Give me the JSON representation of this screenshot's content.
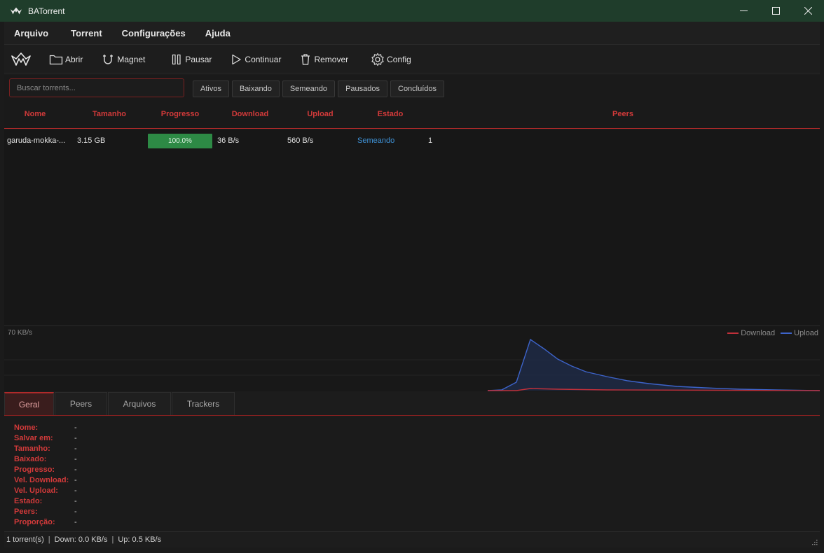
{
  "window": {
    "title": "BATorrent",
    "icon": "bat-logo-icon",
    "controls": [
      "minimize-icon",
      "maximize-icon",
      "close-icon"
    ]
  },
  "menu": [
    "Arquivo",
    "Torrent",
    "Configurações",
    "Ajuda"
  ],
  "toolbar": {
    "open": "Abrir",
    "magnet": "Magnet",
    "pause": "Pausar",
    "resume": "Continuar",
    "remove": "Remover",
    "config": "Config"
  },
  "search": {
    "placeholder": "Buscar torrents..."
  },
  "filters": [
    "Ativos",
    "Baixando",
    "Semeando",
    "Pausados",
    "Concluídos"
  ],
  "table": {
    "columns": [
      "Nome",
      "Tamanho",
      "Progresso",
      "Download",
      "Upload",
      "Estado",
      "Peers"
    ],
    "rows": [
      {
        "name": "garuda-mokka-...",
        "size": "3.15 GB",
        "progress": "100.0%",
        "progress_fraction": 1.0,
        "download": "36 B/s",
        "upload": "560 B/s",
        "state": "Semeando",
        "peers": "1"
      }
    ]
  },
  "graph": {
    "max_label": "70 KB/s",
    "legend": {
      "download": "Download",
      "upload": "Upload"
    },
    "colors": {
      "download": "#c0303a",
      "upload": "#3d63c9"
    }
  },
  "tabs": [
    "Geral",
    "Peers",
    "Arquivos",
    "Trackers"
  ],
  "details": [
    {
      "label": "Nome:",
      "value": "-"
    },
    {
      "label": "Salvar em:",
      "value": "-"
    },
    {
      "label": "Tamanho:",
      "value": "-"
    },
    {
      "label": "Baixado:",
      "value": "-"
    },
    {
      "label": "Progresso:",
      "value": "-"
    },
    {
      "label": "Vel. Download:",
      "value": "-"
    },
    {
      "label": "Vel. Upload:",
      "value": "-"
    },
    {
      "label": "Estado:",
      "value": "-"
    },
    {
      "label": "Peers:",
      "value": "-"
    },
    {
      "label": "Proporção:",
      "value": "-"
    }
  ],
  "status": {
    "count": "1 torrent(s)",
    "down": "Down: 0.0 KB/s",
    "up": "Up: 0.5 KB/s"
  },
  "colors": {
    "accent": "#d23a3a",
    "titlebar": "#1f3d2b",
    "progress": "#2d8a45",
    "state_seeding": "#3f93d8"
  }
}
